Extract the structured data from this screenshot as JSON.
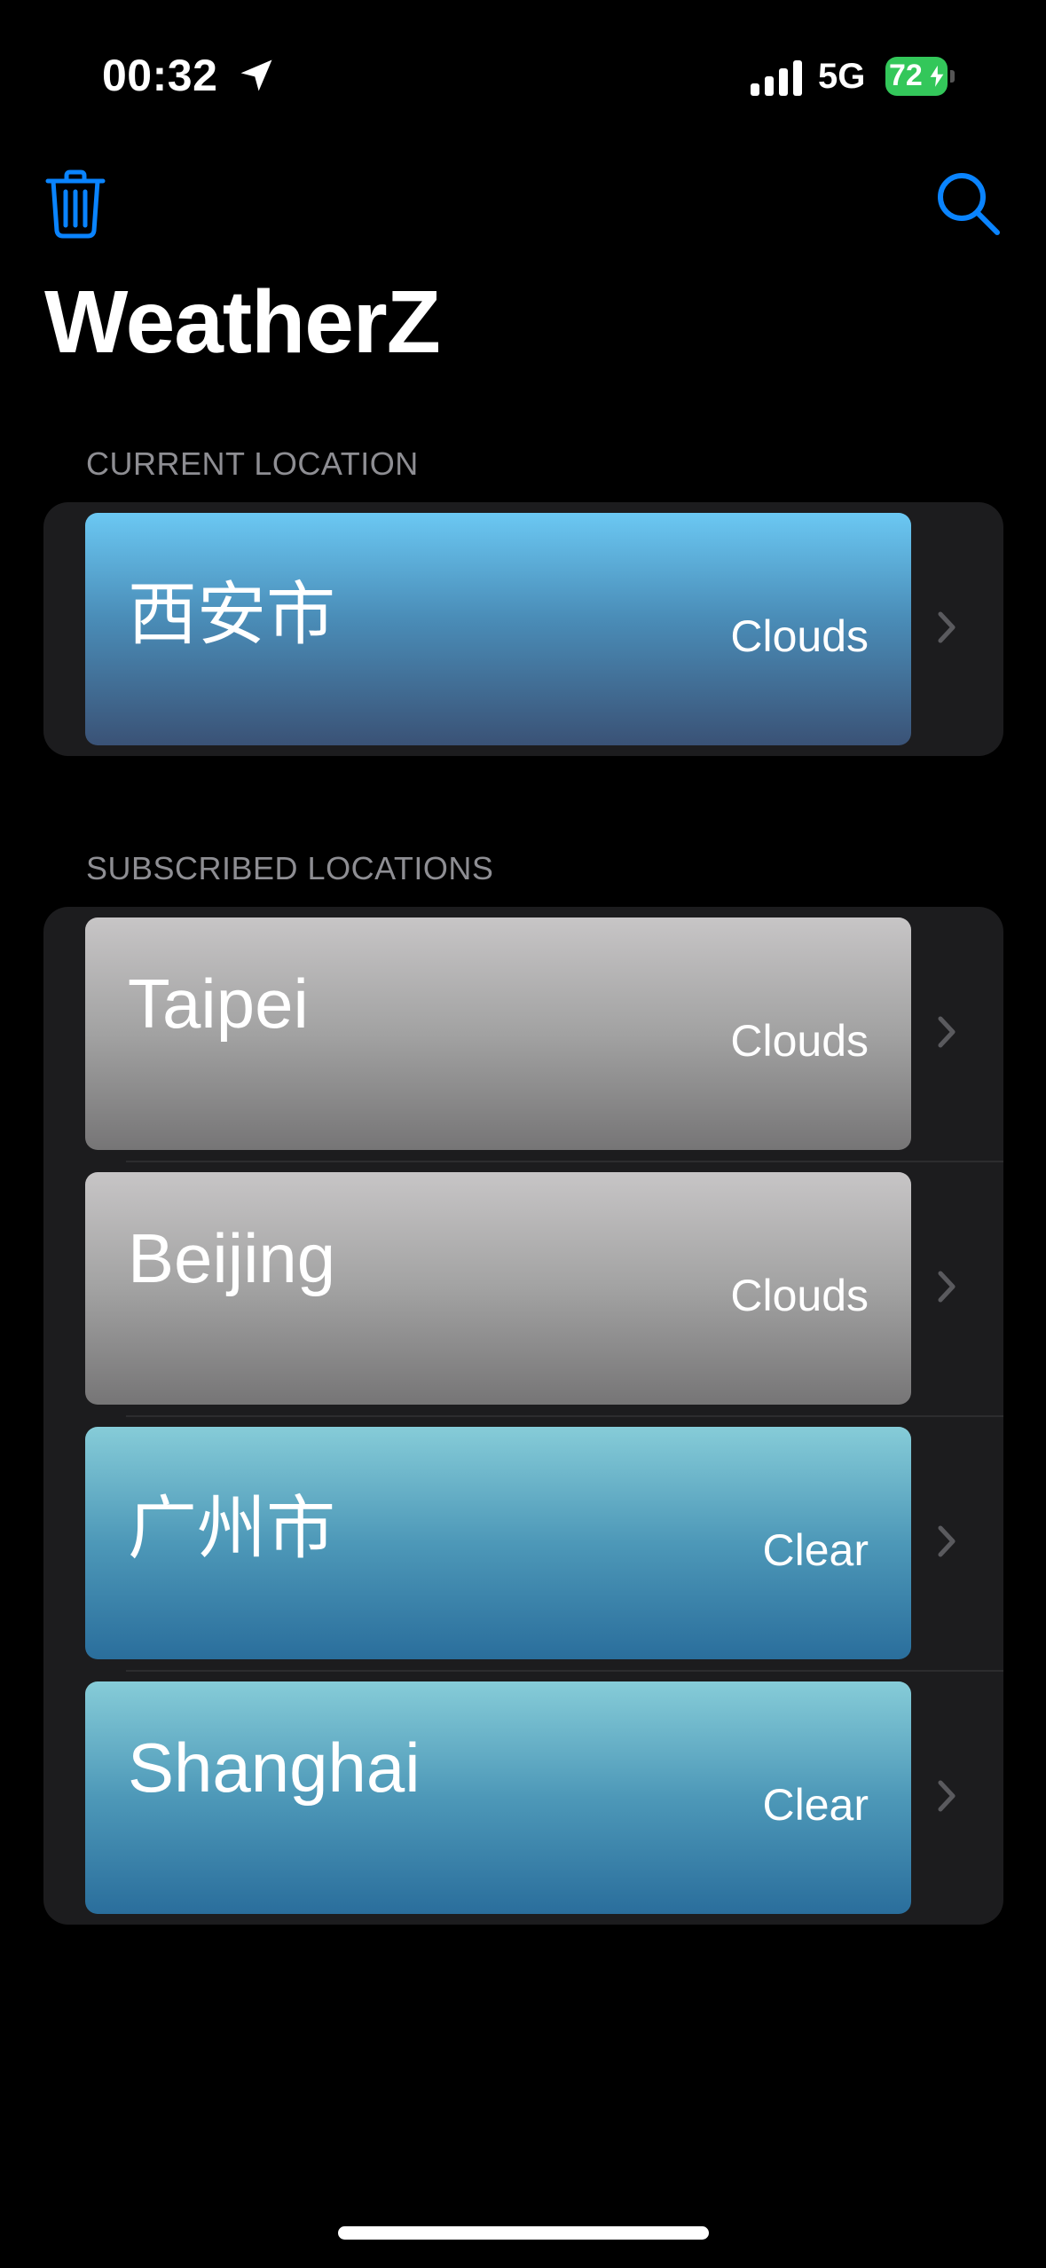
{
  "status_bar": {
    "time": "00:32",
    "network": "5G",
    "battery": "72",
    "battery_color": "#33c75a"
  },
  "toolbar": {
    "trash_icon": "trash-icon",
    "search_icon": "magnifying-glass-icon",
    "accent_color": "#0a84ff"
  },
  "app": {
    "title": "WeatherZ"
  },
  "current": {
    "header": "CURRENT LOCATION",
    "items": [
      {
        "name": "西安市",
        "condition": "Clouds"
      }
    ]
  },
  "subscribed": {
    "header": "SUBSCRIBED LOCATIONS",
    "items": [
      {
        "name": "Taipei",
        "condition": "Clouds"
      },
      {
        "name": "Beijing",
        "condition": "Clouds"
      },
      {
        "name": "广州市",
        "condition": "Clear"
      },
      {
        "name": "Shanghai",
        "condition": "Clear"
      }
    ]
  }
}
